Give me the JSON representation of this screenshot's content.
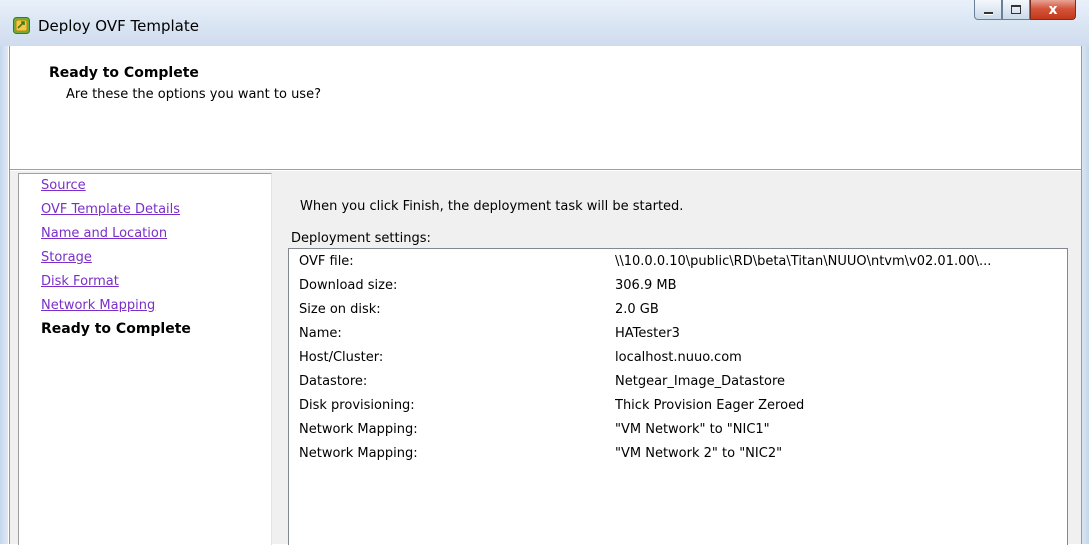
{
  "window": {
    "title": "Deploy OVF Template",
    "close_glyph": "x"
  },
  "header": {
    "title": "Ready to Complete",
    "subtitle": "Are these the options you want to use?"
  },
  "nav": {
    "items": [
      {
        "label": "Source"
      },
      {
        "label": "OVF Template Details"
      },
      {
        "label": "Name and Location"
      },
      {
        "label": "Storage"
      },
      {
        "label": "Disk Format"
      },
      {
        "label": "Network Mapping"
      },
      {
        "label": "Ready to Complete"
      }
    ]
  },
  "main": {
    "intro": "When you click Finish, the deployment task will be started.",
    "settings_label": "Deployment settings:",
    "settings": [
      {
        "key": "OVF file:",
        "value": "\\\\10.0.0.10\\public\\RD\\beta\\Titan\\NUUO\\ntvm\\v02.01.00\\..."
      },
      {
        "key": "Download size:",
        "value": "306.9 MB"
      },
      {
        "key": "Size on disk:",
        "value": "2.0 GB"
      },
      {
        "key": "Name:",
        "value": "HATester3"
      },
      {
        "key": "Host/Cluster:",
        "value": "localhost.nuuo.com"
      },
      {
        "key": "Datastore:",
        "value": "Netgear_Image_Datastore"
      },
      {
        "key": "Disk provisioning:",
        "value": "Thick Provision Eager Zeroed"
      },
      {
        "key": "Network Mapping:",
        "value": "\"VM Network\" to \"NIC1\""
      },
      {
        "key": "Network Mapping:",
        "value": "\"VM Network 2\" to \"NIC2\""
      }
    ]
  },
  "colors": {
    "link_visited": "#7b2fc8",
    "close_button": "#c2381c",
    "titlebar": "#dbe6f4"
  },
  "icons": {
    "app": "ovf-template-icon",
    "minimize": "minimize-icon",
    "maximize": "maximize-icon",
    "close": "close-icon"
  }
}
